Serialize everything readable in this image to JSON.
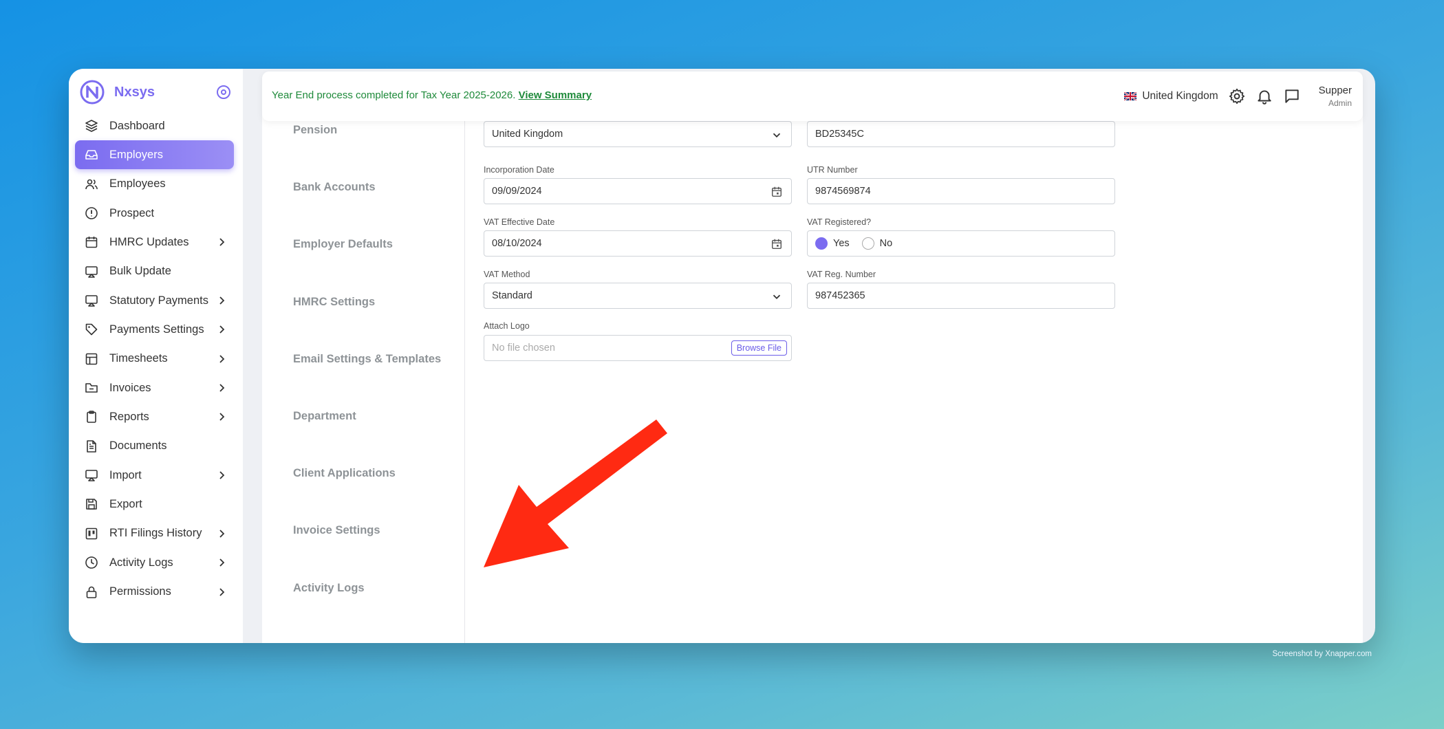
{
  "app": {
    "name": "Nxsys"
  },
  "sidebar": {
    "items": [
      {
        "label": "Dashboard",
        "icon": "layers-icon",
        "has_children": false,
        "active": false
      },
      {
        "label": "Employers",
        "icon": "inbox-icon",
        "has_children": false,
        "active": true
      },
      {
        "label": "Employees",
        "icon": "users-icon",
        "has_children": false,
        "active": false
      },
      {
        "label": "Prospect",
        "icon": "alert-circle-icon",
        "has_children": false,
        "active": false
      },
      {
        "label": "HMRC Updates",
        "icon": "calendar-icon",
        "has_children": true,
        "active": false
      },
      {
        "label": "Bulk Update",
        "icon": "monitor-icon",
        "has_children": false,
        "active": false
      },
      {
        "label": "Statutory Payments",
        "icon": "monitor-icon",
        "has_children": true,
        "active": false
      },
      {
        "label": "Payments Settings",
        "icon": "tag-icon",
        "has_children": true,
        "active": false
      },
      {
        "label": "Timesheets",
        "icon": "table-icon",
        "has_children": true,
        "active": false
      },
      {
        "label": "Invoices",
        "icon": "folder-minus-icon",
        "has_children": true,
        "active": false
      },
      {
        "label": "Reports",
        "icon": "clipboard-icon",
        "has_children": true,
        "active": false
      },
      {
        "label": "Documents",
        "icon": "file-text-icon",
        "has_children": false,
        "active": false
      },
      {
        "label": "Import",
        "icon": "monitor-icon",
        "has_children": true,
        "active": false
      },
      {
        "label": "Export",
        "icon": "save-icon",
        "has_children": false,
        "active": false
      },
      {
        "label": "RTI Filings History",
        "icon": "trello-icon",
        "has_children": true,
        "active": false
      },
      {
        "label": "Activity Logs",
        "icon": "clock-icon",
        "has_children": true,
        "active": false
      },
      {
        "label": "Permissions",
        "icon": "lock-icon",
        "has_children": true,
        "active": false
      }
    ]
  },
  "topbar": {
    "notice": "Year End process completed for Tax Year 2025-2026.",
    "notice_link": "View Summary",
    "country": "United Kingdom",
    "user_name": "Supper",
    "user_role": "Admin"
  },
  "subnav": {
    "items": [
      "Pension",
      "Bank Accounts",
      "Employer Defaults",
      "HMRC Settings",
      "Email Settings & Templates",
      "Department",
      "Client Applications",
      "Invoice Settings",
      "Activity Logs"
    ]
  },
  "form": {
    "country_value": "United Kingdom",
    "reference_value": "BD25345C",
    "incorporation_label": "Incorporation Date",
    "incorporation_value": "09/09/2024",
    "utr_label": "UTR Number",
    "utr_value": "9874569874",
    "vat_effective_label": "VAT Effective Date",
    "vat_effective_value": "08/10/2024",
    "vat_registered_label": "VAT Registered?",
    "vat_registered_yes": "Yes",
    "vat_registered_no": "No",
    "vat_method_label": "VAT Method",
    "vat_method_value": "Standard",
    "vat_reg_label": "VAT Reg. Number",
    "vat_reg_value": "987452365",
    "logo_label": "Attach Logo",
    "logo_placeholder": "No file chosen",
    "browse_label": "Browse File"
  },
  "annotation": {
    "arrow_color": "#ff2a12"
  },
  "credit": "Screenshot by Xnapper.com"
}
